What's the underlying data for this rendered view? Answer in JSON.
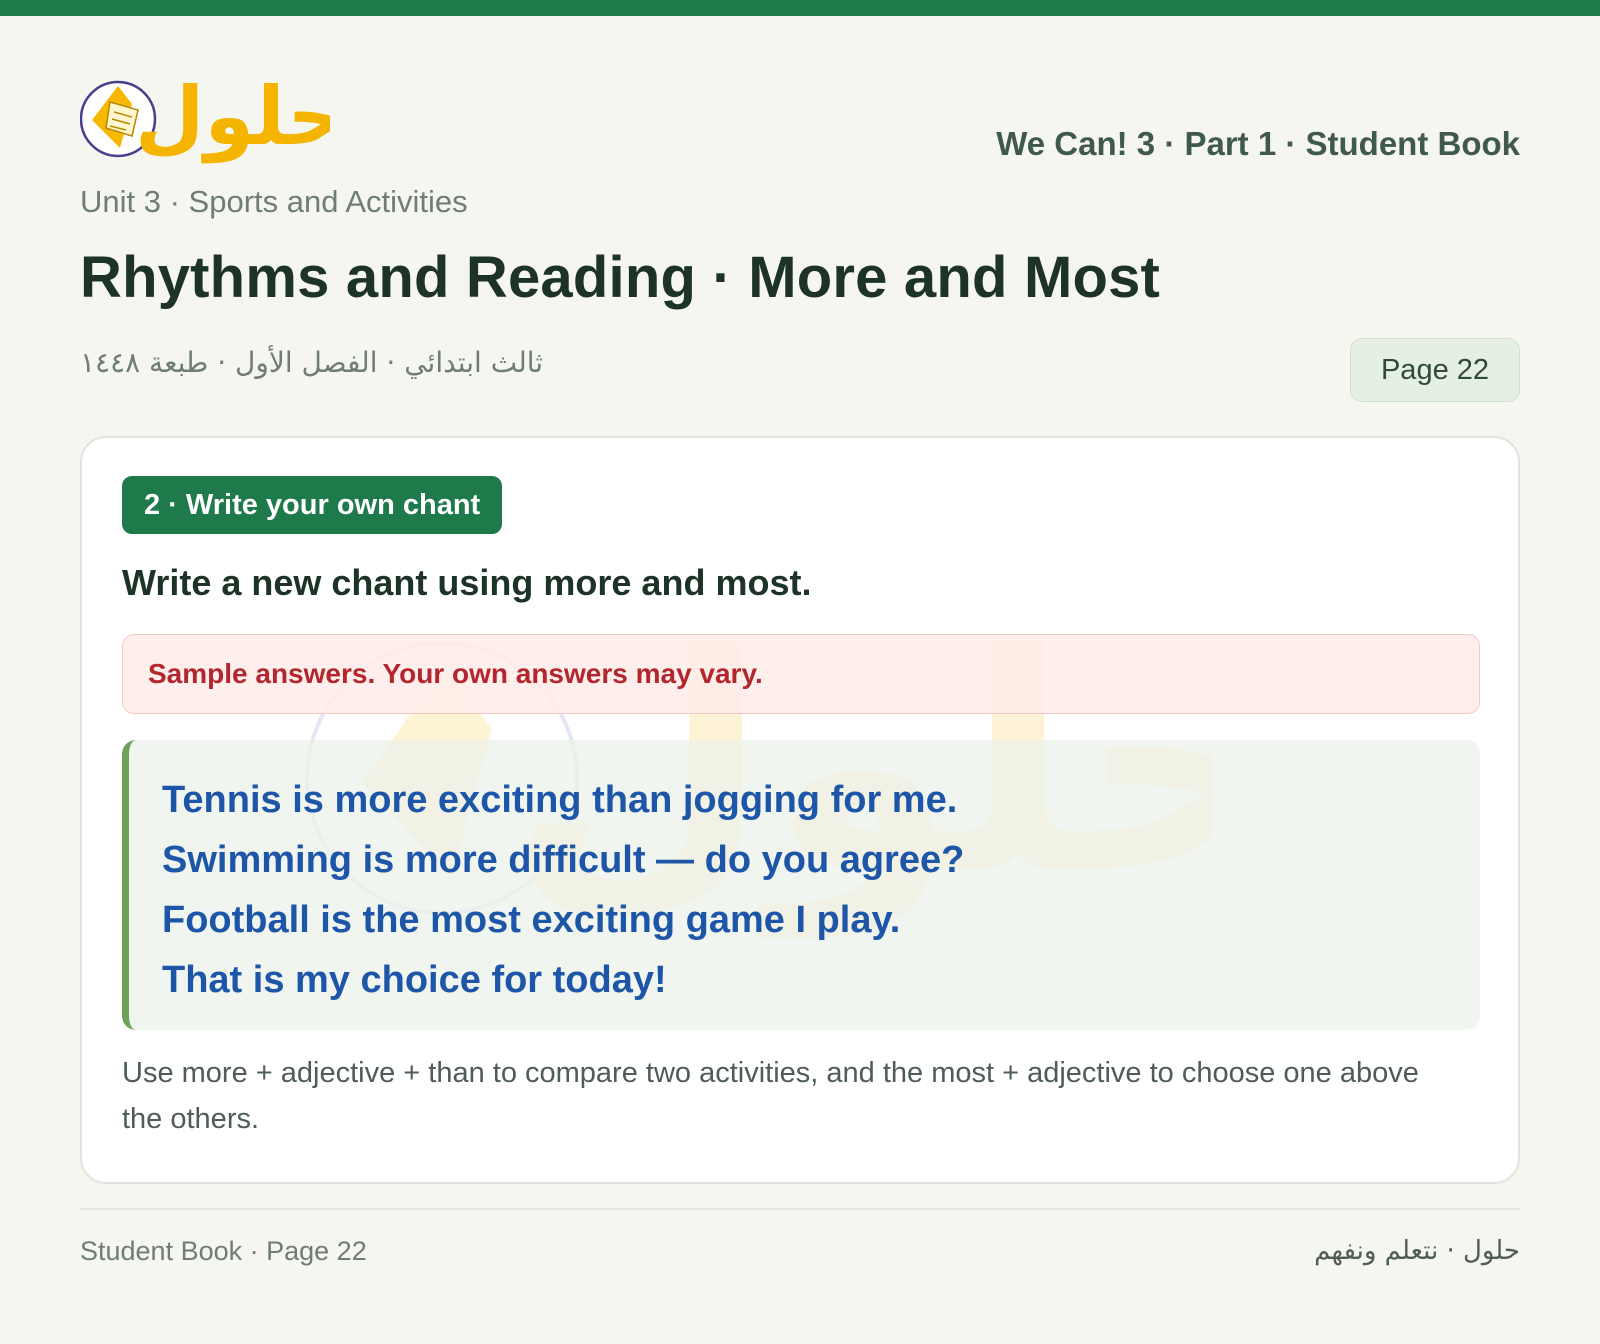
{
  "header": {
    "logo_text": "حلول",
    "book_title": "We Can! 3 · Part 1 · Student Book"
  },
  "unit": "Unit 3 · Sports and Activities",
  "title": "Rhythms and Reading · More and Most",
  "arabic_meta": "ثالث ابتدائي · الفصل الأول · طبعة ١٤٤٨",
  "page_pill": "Page 22",
  "card": {
    "badge": "2 · Write your own chant",
    "instruction": "Write a new chant using more and most.",
    "note": "Sample answers. Your own answers may vary.",
    "answers": [
      "Tennis is more exciting than jogging for me.",
      "Swimming is more difficult — do you agree?",
      "Football is the most exciting game I play.",
      "That is my choice for today!"
    ],
    "explanation": "Use more + adjective + than to compare two activities, and the most + adjective to choose one above the others."
  },
  "footer": {
    "left": "Student Book · Page 22",
    "right": "حلول · نتعلم ونفهم"
  },
  "colors": {
    "brand_green": "#1f7a4b",
    "answer_blue": "#1d56a8",
    "note_red": "#b3262d",
    "logo_yellow": "#f4b400"
  }
}
